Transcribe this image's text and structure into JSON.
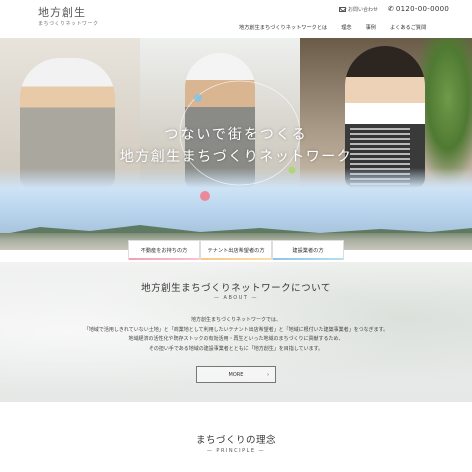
{
  "header": {
    "logo_main": "地方創生",
    "logo_sub": "まちづくりネットワーク",
    "contact_mail": "お問い合わせ",
    "contact_tel": "0120-00-0000",
    "nav": [
      "地方創生まちづくりネットワークとは",
      "理念",
      "事例",
      "よくあるご質問"
    ]
  },
  "hero": {
    "line1": "つないで街をつくる",
    "line2": "地方創生まちづくりネットワーク"
  },
  "buttons": [
    "不動産をお持ちの方",
    "テナント出店希望者の方",
    "建設業者の方"
  ],
  "about": {
    "title": "地方創生まちづくりネットワークについて",
    "subtitle": "— ABOUT —",
    "body": [
      "地方創生まちづくりネットワークでは、",
      "「地域で活用しきれていない土地」と「商業地として利用したいテナント出店希望者」と「地域に根付いた建築事業者」をつなぎます。",
      "地域経済の活性化や既存ストックの有効活用・再生といった地域のまちづくりに貢献するため、",
      "その担い手である地域の建設事業者とともに「地方創生」を目指しています。"
    ],
    "more_label": "MORE",
    "more_arrow": "›"
  },
  "principle": {
    "title": "まちづくりの理念",
    "subtitle": "— PRINCIPLE —"
  },
  "colors": {
    "btn1_accent": "#f4a0b5",
    "btn2_accent": "#f8c68a",
    "btn3_accent": "#8ac6e8"
  }
}
